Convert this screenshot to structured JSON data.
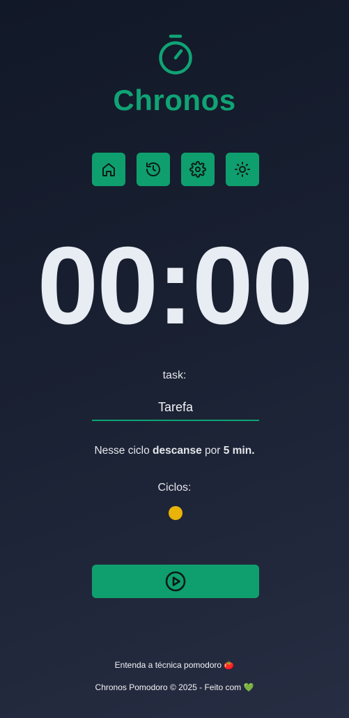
{
  "brand": {
    "title": "Chronos",
    "icon": "stopwatch-icon",
    "accent_color": "#10a374"
  },
  "menu": {
    "items": [
      {
        "name": "home",
        "icon": "home-icon"
      },
      {
        "name": "history",
        "icon": "history-icon"
      },
      {
        "name": "settings",
        "icon": "gear-icon"
      },
      {
        "name": "theme",
        "icon": "sun-icon"
      }
    ],
    "button_color": "#0f9f6e"
  },
  "timer": {
    "display": "00:00"
  },
  "task": {
    "label": "task:",
    "value": "Tarefa"
  },
  "cycle_info": {
    "prefix": "Nesse ciclo ",
    "action": "descanse",
    "middle": " por ",
    "duration": "5 min."
  },
  "cycles": {
    "label": "Ciclos:",
    "dot_color": "#eab308"
  },
  "controls": {
    "play_icon": "play-circle-icon"
  },
  "footer": {
    "link_text": "Entenda a técnica pomodoro 🍅",
    "copyright": "Chronos Pomodoro © 2025 - Feito com 💚"
  }
}
